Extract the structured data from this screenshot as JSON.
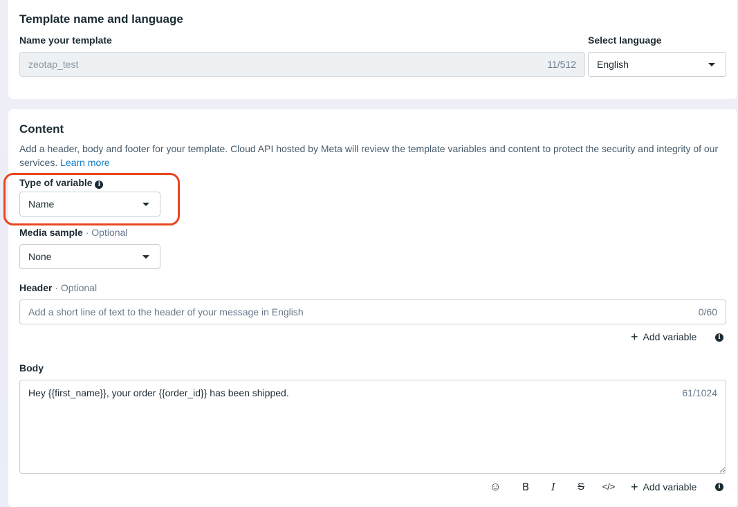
{
  "template_section": {
    "title": "Template name and language",
    "name_label": "Name your template",
    "name_value": "zeotap_test",
    "name_counter": "11/512",
    "language_label": "Select language",
    "language_value": "English"
  },
  "content_section": {
    "title": "Content",
    "description": "Add a header, body and footer for your template. Cloud API hosted by Meta will review the template variables and content to protect the security and integrity of our services.",
    "learn_more": "Learn more",
    "variable_type_label": "Type of variable",
    "variable_type_value": "Name",
    "media_label": "Media sample",
    "optional_text": "· Optional",
    "media_value": "None",
    "header_label": "Header",
    "header_placeholder": "Add a short line of text to the header of your message in English",
    "header_counter": "0/60",
    "add_variable": "Add variable",
    "body_label": "Body",
    "body_value": "Hey {{first_name}}, your order {{order_id}} has been shipped.",
    "body_counter": "61/1024"
  },
  "toolbar": {
    "emoji": "☺",
    "bold": "B",
    "italic": "I",
    "strike": "S",
    "code": "</>"
  },
  "colors": {
    "highlight": "#e8461f",
    "link": "#0a7cc1"
  }
}
